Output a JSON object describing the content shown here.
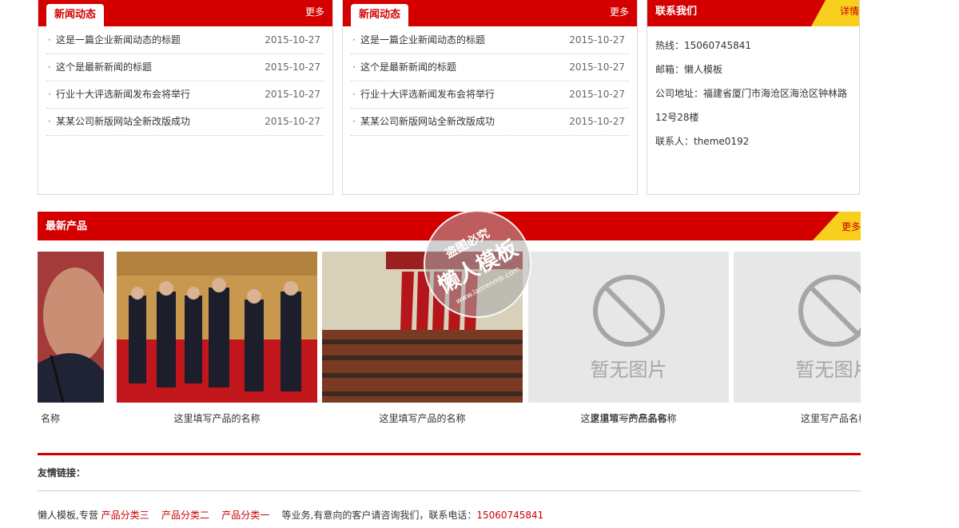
{
  "news_box_1": {
    "tab": "新闻动态",
    "more": "更多",
    "items": [
      {
        "title": "这是一篇企业新闻动态的标题",
        "date": "2015-10-27"
      },
      {
        "title": "这个是最新新闻的标题",
        "date": "2015-10-27"
      },
      {
        "title": "行业十大评选新闻发布会将举行",
        "date": "2015-10-27"
      },
      {
        "title": "某某公司新版网站全新改版成功",
        "date": "2015-10-27"
      }
    ]
  },
  "news_box_2": {
    "tab": "新闻动态",
    "more": "更多",
    "items": [
      {
        "title": "这是一篇企业新闻动态的标题",
        "date": "2015-10-27"
      },
      {
        "title": "这个是最新新闻的标题",
        "date": "2015-10-27"
      },
      {
        "title": "行业十大评选新闻发布会将举行",
        "date": "2015-10-27"
      },
      {
        "title": "某某公司新版网站全新改版成功",
        "date": "2015-10-27"
      }
    ]
  },
  "contact": {
    "title": "联系我们",
    "more": "详情",
    "hotline": "热线：15060745841",
    "email": "邮箱：懒人模板",
    "address_1": "公司地址：福建省厦门市海沧区海沧区钟林路",
    "address_2": "12号28楼",
    "person": "联系人：theme0192"
  },
  "products": {
    "title": "最新产品",
    "more": "更多",
    "no_image_text": "暂无图片",
    "items": [
      {
        "name": "这里填写产品的名称"
      },
      {
        "name": "这里填写产品的名称"
      },
      {
        "name": "这里填写产品名称"
      },
      {
        "name": "这里填写一的产品名称"
      },
      {
        "name": "这里写产品名称"
      }
    ],
    "partial_first_name": "名称"
  },
  "watermark": {
    "line1": "盗图必究",
    "line2": "懒人模板",
    "line3": "www.lanrenmb.com"
  },
  "footer": {
    "links_title": "友情链接：",
    "prefix": "懒人模板,专营",
    "cat3": "产品分类三",
    "cat2": "产品分类二",
    "cat1": "产品分类一",
    "suffix": "等业务,有意向的客户请咨询我们，联系电话：",
    "phone": "15060745841"
  },
  "colors": {
    "brand_red": "#d40000",
    "accent_yellow": "#f8cf1c"
  }
}
